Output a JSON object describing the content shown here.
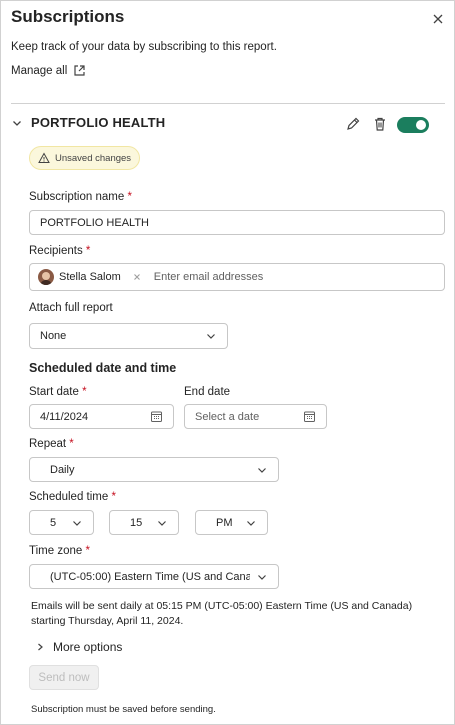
{
  "panel": {
    "title": "Subscriptions",
    "description": "Keep track of your data by subscribing to this report.",
    "manage_all": "Manage all"
  },
  "subscription": {
    "name_header": "PORTFOLIO HEALTH",
    "enabled": true,
    "unsaved_badge": "Unsaved changes",
    "fields": {
      "subscription_name": {
        "label": "Subscription name",
        "required_mark": "*",
        "value": "PORTFOLIO HEALTH"
      },
      "recipients": {
        "label": "Recipients",
        "required_mark": "*",
        "chip": "Stella Salom",
        "placeholder": "Enter email addresses"
      },
      "attach_full_report": {
        "label": "Attach full report",
        "value": "None"
      }
    },
    "schedule": {
      "heading": "Scheduled date and time",
      "start_date": {
        "label": "Start date",
        "required_mark": "*",
        "value": "4/11/2024"
      },
      "end_date": {
        "label": "End date",
        "placeholder": "Select a date"
      },
      "repeat": {
        "label": "Repeat",
        "required_mark": "*",
        "value": "Daily"
      },
      "scheduled_time": {
        "label": "Scheduled time",
        "required_mark": "*",
        "hour": "5",
        "minute": "15",
        "period": "PM"
      },
      "time_zone": {
        "label": "Time zone",
        "required_mark": "*",
        "value": "(UTC-05:00) Eastern Time (US and Cana"
      },
      "summary": "Emails will be sent daily at 05:15 PM (UTC-05:00) Eastern Time (US and Canada) starting Thursday, April 11, 2024."
    },
    "more_options": "More options",
    "send_now": "Send now",
    "footnote": "Subscription must be saved before sending."
  },
  "colors": {
    "toggle_on": "#1b7e5e",
    "required": "#c50f1f",
    "badge_bg": "#fbf7dc"
  },
  "icons": [
    "close-icon",
    "external-link-icon",
    "chevron-down-icon",
    "pencil-icon",
    "trash-icon",
    "warning-icon",
    "calendar-icon",
    "chevron-right-icon",
    "remove-icon"
  ]
}
